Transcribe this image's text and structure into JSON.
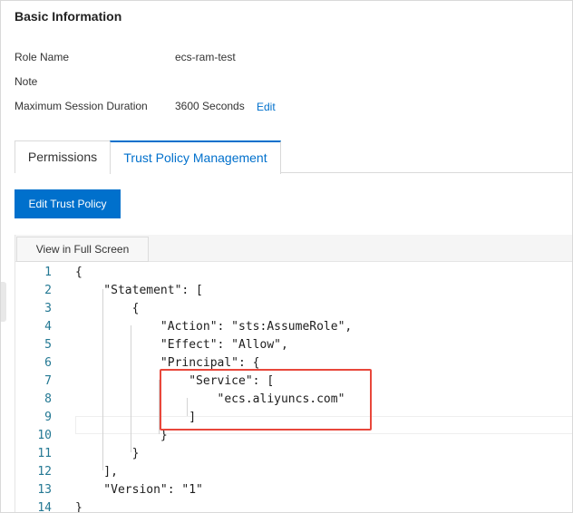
{
  "basic_info": {
    "title": "Basic Information",
    "role_name_label": "Role Name",
    "role_name_value": "ecs-ram-test",
    "note_label": "Note",
    "max_session_label": "Maximum Session Duration",
    "max_session_value": "3600 Seconds",
    "edit_label": "Edit"
  },
  "tabs": [
    {
      "label": "Permissions",
      "active": false
    },
    {
      "label": "Trust Policy Management",
      "active": true
    }
  ],
  "toolbar": {
    "edit_trust_policy_label": "Edit Trust Policy",
    "view_full_screen_label": "View in Full Screen"
  },
  "editor": {
    "lines": [
      {
        "num": "1",
        "text": "{"
      },
      {
        "num": "2",
        "text": "    \"Statement\": ["
      },
      {
        "num": "3",
        "text": "        {"
      },
      {
        "num": "4",
        "text": "            \"Action\": \"sts:AssumeRole\","
      },
      {
        "num": "5",
        "text": "            \"Effect\": \"Allow\","
      },
      {
        "num": "6",
        "text": "            \"Principal\": {"
      },
      {
        "num": "7",
        "text": "                \"Service\": ["
      },
      {
        "num": "8",
        "text": "                    \"ecs.aliyuncs.com\""
      },
      {
        "num": "9",
        "text": "                ]"
      },
      {
        "num": "10",
        "text": "            }"
      },
      {
        "num": "11",
        "text": "        }"
      },
      {
        "num": "12",
        "text": "    ],"
      },
      {
        "num": "13",
        "text": "    \"Version\": \"1\""
      },
      {
        "num": "14",
        "text": "}"
      }
    ]
  },
  "colors": {
    "accent": "#0070cc",
    "highlight": "#e8473b",
    "line_number": "#237893"
  }
}
